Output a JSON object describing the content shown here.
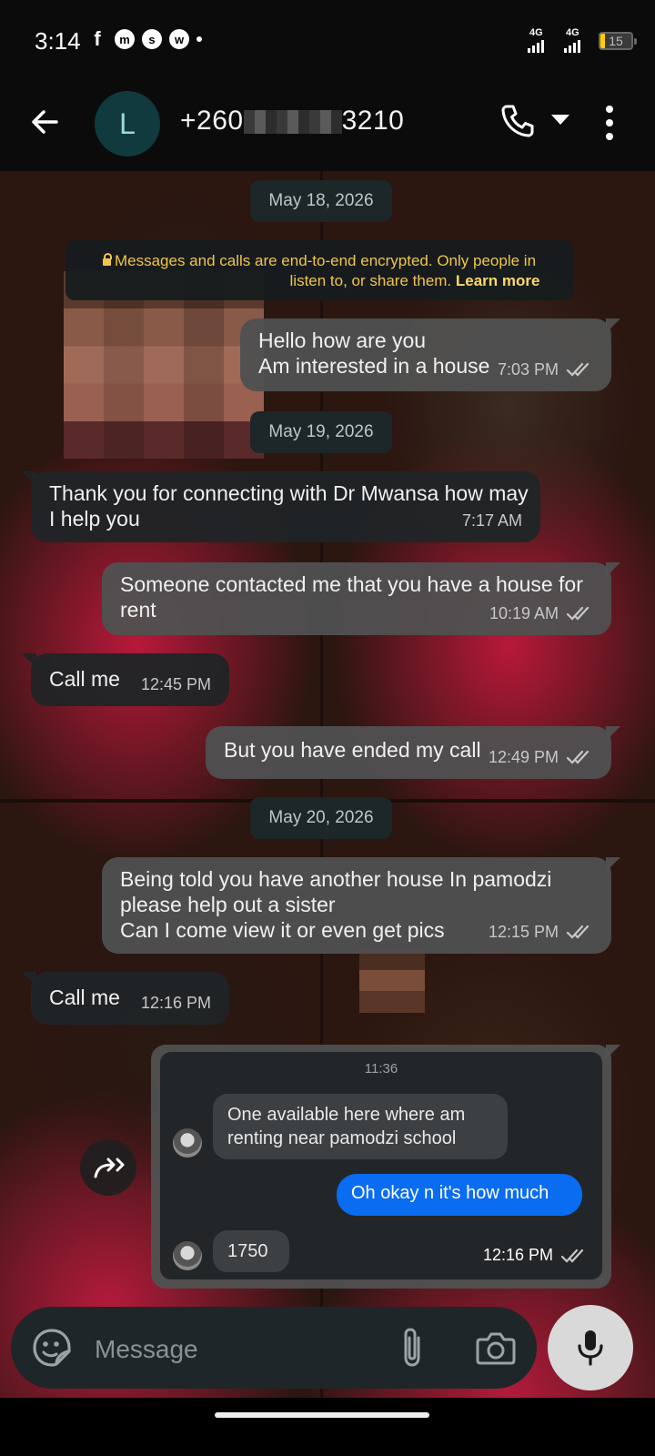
{
  "status_bar": {
    "time": "3:14",
    "apps": [
      "f",
      "m",
      "s",
      "w"
    ],
    "network_1": "4G",
    "network_2": "4G",
    "battery": "15",
    "battery_color": "#ffcc00"
  },
  "header": {
    "avatar_letter": "L",
    "contact_prefix": "+260",
    "contact_suffix": "3210",
    "avatar_color": "#103a3d"
  },
  "encryption_notice": {
    "line1": "Messages and calls are end-to-end encrypted. Only people in",
    "line2": "listen to, or share them.",
    "link": "Learn more"
  },
  "dates": [
    "May 18, 2026",
    "May 19, 2026",
    "May 20, 2026"
  ],
  "messages": [
    {
      "direction": "out",
      "text": "Hello how are you\nAm interested in a house",
      "time": "7:03 PM",
      "status": "read"
    },
    {
      "direction": "in",
      "text": "Thank you for connecting with Dr Mwansa how may\nI help you",
      "time": "7:17 AM"
    },
    {
      "direction": "out",
      "text": "Someone contacted me that you have a house for\nrent",
      "time": "10:19 AM",
      "status": "read"
    },
    {
      "direction": "in",
      "text": "Call me",
      "time": "12:45 PM"
    },
    {
      "direction": "out",
      "text": "But you have ended my call",
      "time": "12:49 PM",
      "status": "read"
    },
    {
      "direction": "out",
      "text": "Being told you have another house In pamodzi\nplease help out a sister\nCan I come view it or even get pics",
      "time": "12:15 PM",
      "status": "read"
    },
    {
      "direction": "in",
      "text": "Call me",
      "time": "12:16 PM"
    }
  ],
  "image_message": {
    "inner_time": "11:36",
    "inner_msg_1": "One available here where am\nrenting near pamodzi school",
    "inner_msg_2": "Oh okay n it's how much",
    "inner_msg_3": "1750",
    "time": "12:16 PM",
    "status": "read"
  },
  "composer": {
    "placeholder": "Message"
  },
  "colors": {
    "outgoing_bubble": "#505050",
    "incoming_bubble": "#202426",
    "date_chip": "#1d2628",
    "notice_text": "#f1c54a",
    "read_ticks": "#c8c8c8",
    "inner_outgoing": "#0a6cf0"
  },
  "icons": [
    "back-arrow-icon",
    "phone-icon",
    "dropdown-icon",
    "more-vert-icon",
    "lock-icon",
    "double-check-icon",
    "forward-icon",
    "sticker-icon",
    "attach-icon",
    "camera-icon",
    "mic-icon"
  ]
}
